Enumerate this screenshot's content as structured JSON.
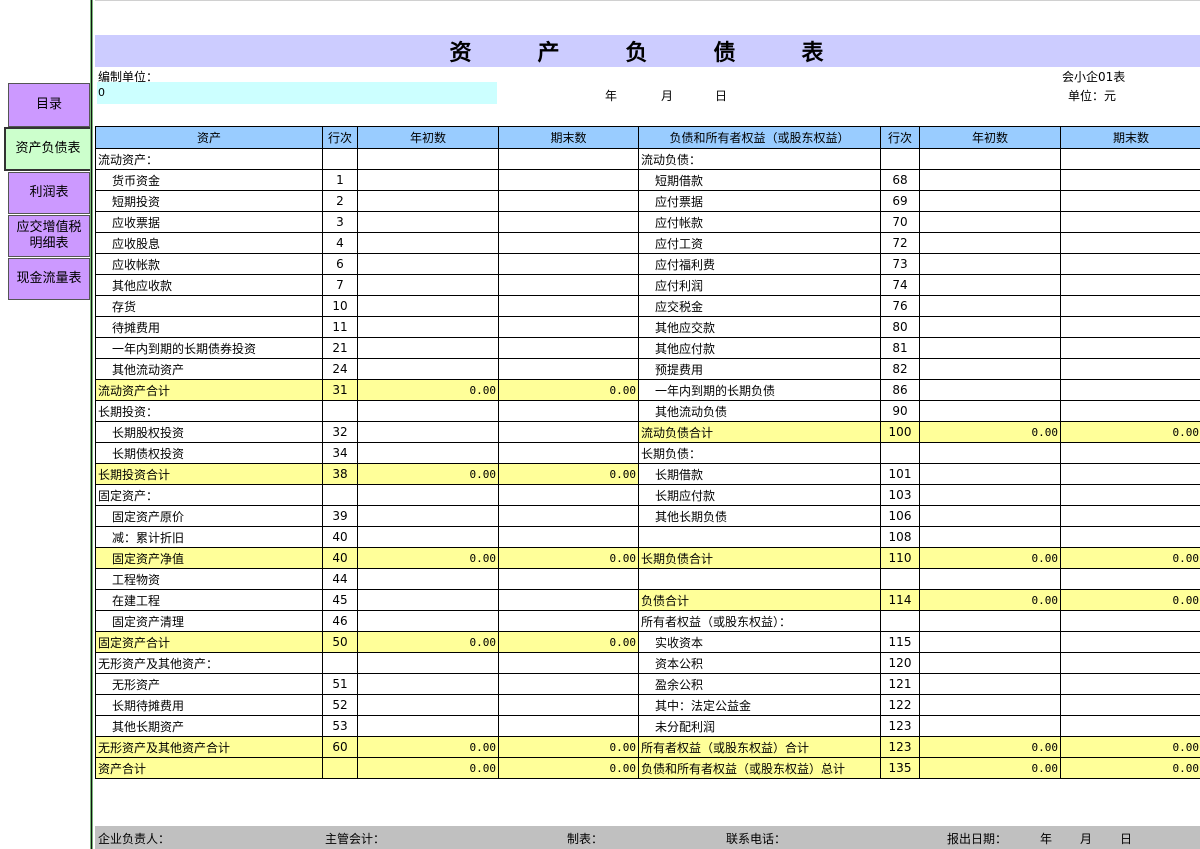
{
  "nav": {
    "items": [
      {
        "label": "目录"
      },
      {
        "label": "资产负债表"
      },
      {
        "label": "利润表"
      },
      {
        "label": "应交增值税明细表"
      },
      {
        "label": "现金流量表"
      }
    ]
  },
  "sheet": {
    "title": "资　产　负　债　表",
    "compiler_label": "编制单位：",
    "compiler_value": "0",
    "date_year": "年",
    "date_month": "月",
    "date_day": "日",
    "form_code": "会小企01表",
    "unit": "单位：元"
  },
  "columns": [
    "资产",
    "行次",
    "年初数",
    "期末数",
    "负债和所有者权益（或股东权益）",
    "行次",
    "年初数",
    "期末数"
  ],
  "rows": [
    {
      "la": "流动资产：",
      "ln": "",
      "lb": "",
      "le": "",
      "ra": "流动负债：",
      "rn": "",
      "rb": "",
      "re": ""
    },
    {
      "la": "货币资金",
      "ln": "1",
      "lb": "",
      "le": "",
      "ra": "短期借款",
      "rn": "68",
      "rb": "",
      "re": ""
    },
    {
      "la": "短期投资",
      "ln": "2",
      "lb": "",
      "le": "",
      "ra": "应付票据",
      "rn": "69",
      "rb": "",
      "re": ""
    },
    {
      "la": "应收票据",
      "ln": "3",
      "lb": "",
      "le": "",
      "ra": "应付帐款",
      "rn": "70",
      "rb": "",
      "re": ""
    },
    {
      "la": "应收股息",
      "ln": "4",
      "lb": "",
      "le": "",
      "ra": "应付工资",
      "rn": "72",
      "rb": "",
      "re": ""
    },
    {
      "la": "应收帐款",
      "ln": "6",
      "lb": "",
      "le": "",
      "ra": "应付福利费",
      "rn": "73",
      "rb": "",
      "re": ""
    },
    {
      "la": "其他应收款",
      "ln": "7",
      "lb": "",
      "le": "",
      "ra": "应付利润",
      "rn": "74",
      "rb": "",
      "re": ""
    },
    {
      "la": "存货",
      "ln": "10",
      "lb": "",
      "le": "",
      "ra": "应交税金",
      "rn": "76",
      "rb": "",
      "re": ""
    },
    {
      "la": "待摊费用",
      "ln": "11",
      "lb": "",
      "le": "",
      "ra": "其他应交款",
      "rn": "80",
      "rb": "",
      "re": ""
    },
    {
      "la": "一年内到期的长期债券投资",
      "ln": "21",
      "lb": "",
      "le": "",
      "ra": "其他应付款",
      "rn": "81",
      "rb": "",
      "re": ""
    },
    {
      "la": "其他流动资产",
      "ln": "24",
      "lb": "",
      "le": "",
      "ra": "预提费用",
      "rn": "82",
      "rb": "",
      "re": ""
    },
    {
      "la": "流动资产合计",
      "ln": "31",
      "lb": "0.00",
      "le": "0.00",
      "ra": "一年内到期的长期负债",
      "rn": "86",
      "rb": "",
      "re": ""
    },
    {
      "la": "长期投资：",
      "ln": "",
      "lb": "",
      "le": "",
      "ra": "其他流动负债",
      "rn": "90",
      "rb": "",
      "re": ""
    },
    {
      "la": "长期股权投资",
      "ln": "32",
      "lb": "",
      "le": "",
      "ra": "流动负债合计",
      "rn": "100",
      "rb": "0.00",
      "re": "0.00"
    },
    {
      "la": "长期债权投资",
      "ln": "34",
      "lb": "",
      "le": "",
      "ra": "长期负债：",
      "rn": "",
      "rb": "",
      "re": ""
    },
    {
      "la": "长期投资合计",
      "ln": "38",
      "lb": "0.00",
      "le": "0.00",
      "ra": "长期借款",
      "rn": "101",
      "rb": "",
      "re": ""
    },
    {
      "la": "固定资产：",
      "ln": "",
      "lb": "",
      "le": "",
      "ra": "长期应付款",
      "rn": "103",
      "rb": "",
      "re": ""
    },
    {
      "la": "固定资产原价",
      "ln": "39",
      "lb": "",
      "le": "",
      "ra": "其他长期负债",
      "rn": "106",
      "rb": "",
      "re": ""
    },
    {
      "la": "减：累计折旧",
      "ln": "40",
      "lb": "",
      "le": "",
      "ra": "",
      "rn": "108",
      "rb": "",
      "re": ""
    },
    {
      "la": "固定资产净值",
      "ln": "40",
      "lb": "0.00",
      "le": "0.00",
      "ra": "长期负债合计",
      "rn": "110",
      "rb": "0.00",
      "re": "0.00"
    },
    {
      "la": "工程物资",
      "ln": "44",
      "lb": "",
      "le": "",
      "ra": "",
      "rn": "",
      "rb": "",
      "re": ""
    },
    {
      "la": "在建工程",
      "ln": "45",
      "lb": "",
      "le": "",
      "ra": "负债合计",
      "rn": "114",
      "rb": "0.00",
      "re": "0.00"
    },
    {
      "la": "固定资产清理",
      "ln": "46",
      "lb": "",
      "le": "",
      "ra": "所有者权益（或股东权益）：",
      "rn": "",
      "rb": "",
      "re": ""
    },
    {
      "la": "固定资产合计",
      "ln": "50",
      "lb": "0.00",
      "le": "0.00",
      "ra": "实收资本",
      "rn": "115",
      "rb": "",
      "re": ""
    },
    {
      "la": "无形资产及其他资产：",
      "ln": "",
      "lb": "",
      "le": "",
      "ra": "资本公积",
      "rn": "120",
      "rb": "",
      "re": ""
    },
    {
      "la": "无形资产",
      "ln": "51",
      "lb": "",
      "le": "",
      "ra": "盈余公积",
      "rn": "121",
      "rb": "",
      "re": ""
    },
    {
      "la": "长期待摊费用",
      "ln": "52",
      "lb": "",
      "le": "",
      "ra": "其中：法定公益金",
      "rn": "122",
      "rb": "",
      "re": ""
    },
    {
      "la": "其他长期资产",
      "ln": "53",
      "lb": "",
      "le": "",
      "ra": "未分配利润",
      "rn": "123",
      "rb": "",
      "re": ""
    },
    {
      "la": "无形资产及其他资产合计",
      "ln": "60",
      "lb": "0.00",
      "le": "0.00",
      "ra": "所有者权益（或股东权益）合计",
      "rn": "123",
      "rb": "0.00",
      "re": "0.00"
    },
    {
      "la": "资产合计",
      "ln": "",
      "lb": "0.00",
      "le": "0.00",
      "ra": "负债和所有者权益（或股东权益）总计",
      "rn": "135",
      "rb": "0.00",
      "re": "0.00"
    }
  ],
  "footer": {
    "manager": "企业负责人：",
    "accountant": "主管会计：",
    "preparer": "制表：",
    "phone": "联系电话：",
    "report_date": "报出日期：",
    "year": "年",
    "month": "月",
    "day": "日"
  },
  "colors": {
    "nav_button": "#cc99ff",
    "nav_active": "#ccffcc",
    "title_bg": "#ccccff",
    "header_bg": "#99ccff",
    "subtotal_bg": "#ffff99",
    "input_bg": "#ccffff",
    "footer_bg": "#c0c0c0"
  }
}
